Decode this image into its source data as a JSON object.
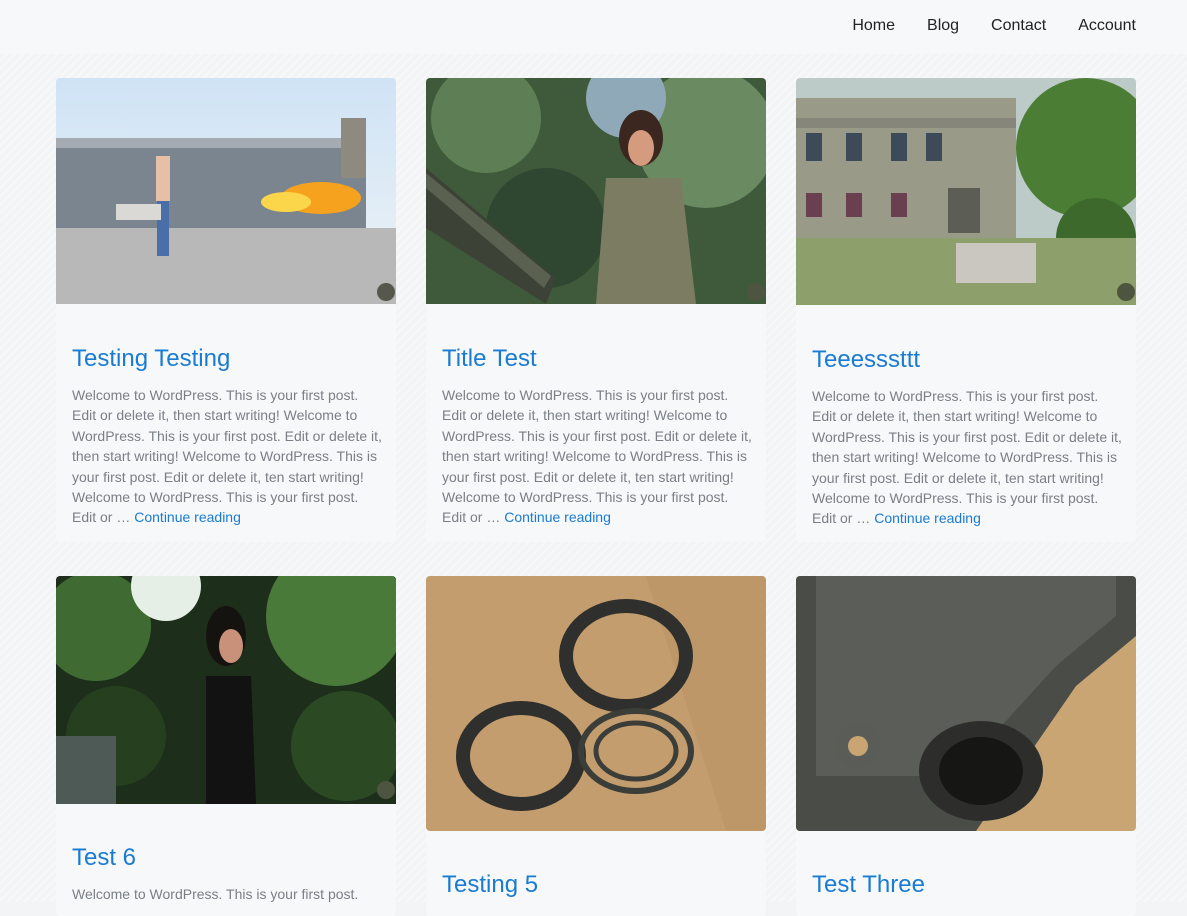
{
  "nav": {
    "items": [
      "Home",
      "Blog",
      "Contact",
      "Account"
    ]
  },
  "excerpt_text": "Welcome to WordPress. This is your first post. Edit or delete it, then start writing! Welcome to WordPress. This is your first post. Edit or delete it, then start writing! Welcome to WordPress. This is your first post. Edit or delete it, ten start writing! Welcome to WordPress. This is your first post. Edit or …",
  "continue_label": "Continue reading",
  "posts": [
    {
      "title": "Testing Testing",
      "image": "woman-with-flamethrower-photo"
    },
    {
      "title": "Title Test",
      "image": "woman-on-tank-barrel-photo"
    },
    {
      "title": "Teeesssttt",
      "image": "old-manor-house-photo"
    },
    {
      "title": "Test 6",
      "image": "woman-in-garden-photo"
    },
    {
      "title": "Testing 5",
      "image": "rifle-barrel-nut-rings-photo"
    },
    {
      "title": "Test Three",
      "image": "rifle-upper-receiver-photo"
    }
  ],
  "excerpt_second_row": "Welcome to WordPress. This is your first post."
}
